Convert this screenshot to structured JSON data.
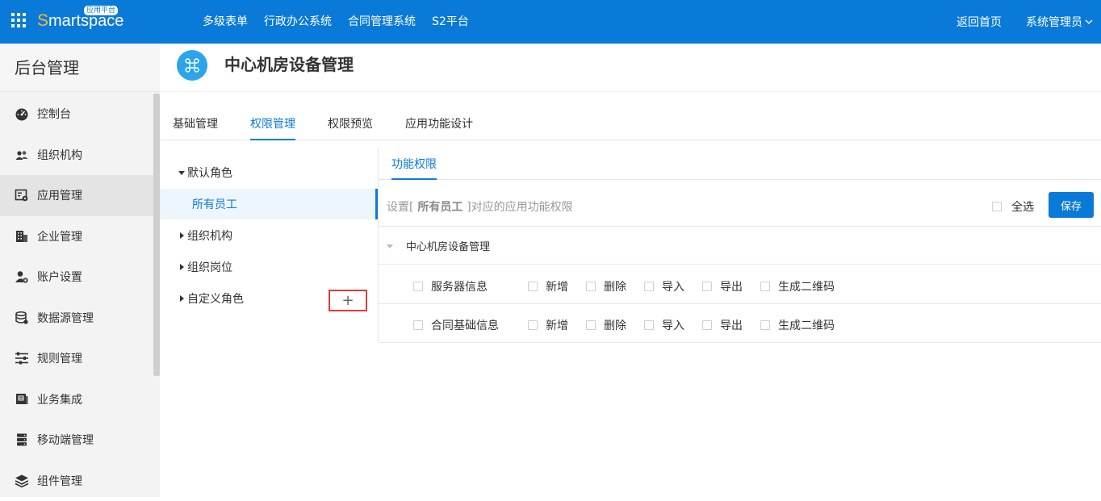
{
  "topbar": {
    "logo_text": "martspace",
    "logo_first": "S",
    "logo_badge": "应用平台",
    "nav": [
      "多级表单",
      "行政办公系统",
      "合同管理系统",
      "S2平台"
    ],
    "home": "返回首页",
    "user": "系统管理员",
    "bg_color": "#0a7ad8"
  },
  "sidebar": {
    "title": "后台管理",
    "items": [
      {
        "label": "控制台",
        "icon": "dashboard-icon"
      },
      {
        "label": "组织机构",
        "icon": "users-icon"
      },
      {
        "label": "应用管理",
        "icon": "app-settings-icon",
        "active": true
      },
      {
        "label": "企业管理",
        "icon": "building-icon"
      },
      {
        "label": "账户设置",
        "icon": "user-gear-icon"
      },
      {
        "label": "数据源管理",
        "icon": "database-icon"
      },
      {
        "label": "规则管理",
        "icon": "sliders-icon"
      },
      {
        "label": "业务集成",
        "icon": "integration-icon"
      },
      {
        "label": "移动端管理",
        "icon": "server-icon"
      },
      {
        "label": "组件管理",
        "icon": "layers-icon"
      }
    ]
  },
  "app": {
    "title": "中心机房设备管理",
    "icon": "command-icon",
    "icon_color": "#2ba4ea"
  },
  "tabs": [
    "基础管理",
    "权限管理",
    "权限预览",
    "应用功能设计"
  ],
  "active_tab": "权限管理",
  "tree": {
    "default_role": "默认角色",
    "all_staff": "所有员工",
    "org": "组织机构",
    "post": "组织岗位",
    "custom": "自定义角色",
    "add_symbol": "+"
  },
  "panel": {
    "subtab": "功能权限",
    "hint_prefix": "设置[",
    "hint_role": " 所有员工 ",
    "hint_suffix": "]对应的应用功能权限",
    "select_all": "全选",
    "save": "保存",
    "group": "中心机房设备管理",
    "rows": [
      {
        "name": "服务器信息",
        "perms": [
          "新增",
          "删除",
          "导入",
          "导出",
          "生成二维码"
        ]
      },
      {
        "name": "合同基础信息",
        "perms": [
          "新增",
          "删除",
          "导入",
          "导出",
          "生成二维码"
        ]
      }
    ]
  }
}
